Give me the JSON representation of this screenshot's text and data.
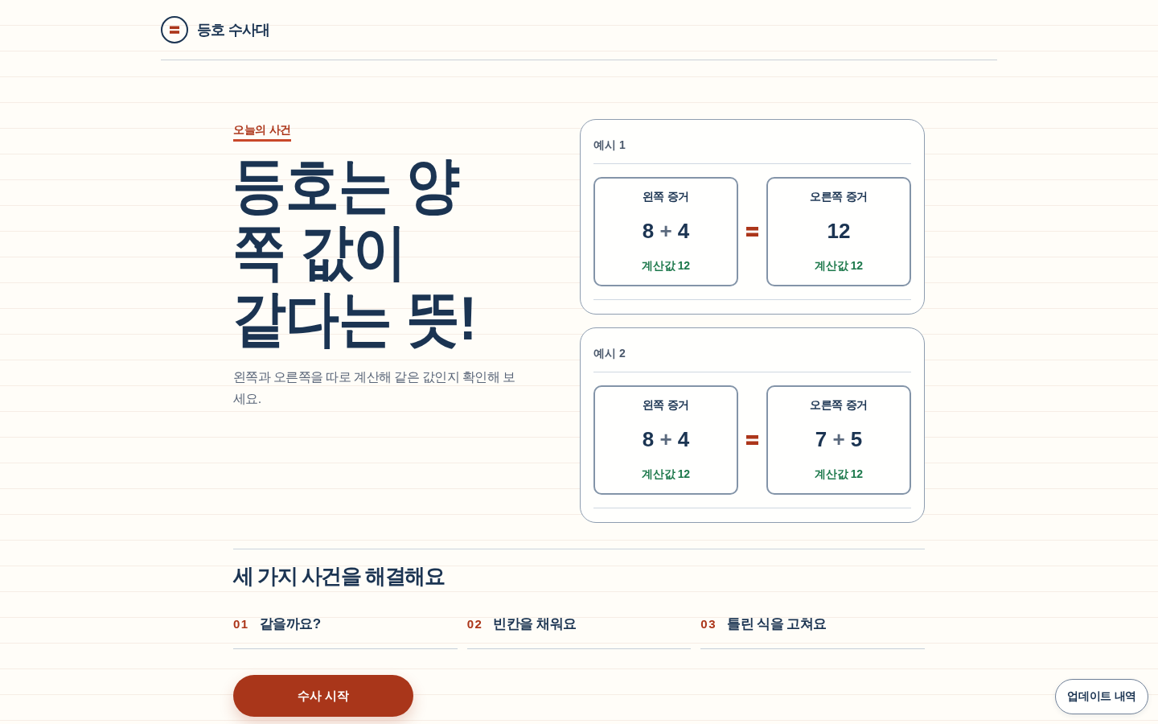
{
  "header": {
    "title": "등호 수사대"
  },
  "hero": {
    "eyebrow": "오늘의 사건",
    "headline": "등호는 양쪽 값이\n같다는 뜻!",
    "description": "왼쪽과 오른쪽을 따로 계산해 같은 값인지 확인해 보세요."
  },
  "examples": [
    {
      "title": "예시 1",
      "sides": [
        {
          "label": "왼쪽 증거",
          "expression": [
            {
              "kind": "number",
              "text": "8"
            },
            {
              "kind": "operator",
              "text": "+"
            },
            {
              "kind": "number",
              "text": "4"
            }
          ],
          "result": "계산값 12"
        },
        {
          "label": "오른쪽 증거",
          "expression": [
            {
              "kind": "number",
              "text": "12"
            }
          ],
          "result": "계산값 12"
        }
      ]
    },
    {
      "title": "예시 2",
      "sides": [
        {
          "label": "왼쪽 증거",
          "expression": [
            {
              "kind": "number",
              "text": "8"
            },
            {
              "kind": "operator",
              "text": "+"
            },
            {
              "kind": "number",
              "text": "4"
            }
          ],
          "result": "계산값 12"
        },
        {
          "label": "오른쪽 증거",
          "expression": [
            {
              "kind": "number",
              "text": "7"
            },
            {
              "kind": "operator",
              "text": "+"
            },
            {
              "kind": "number",
              "text": "5"
            }
          ],
          "result": "계산값 12"
        }
      ]
    }
  ],
  "missions": {
    "title": "세 가지 사건을 해결해요",
    "steps": [
      {
        "number": "01",
        "title": "같을까요?"
      },
      {
        "number": "02",
        "title": "빈칸을 채워요"
      },
      {
        "number": "03",
        "title": "틀린 식을 고쳐요"
      }
    ]
  },
  "start_button": "수사 시작",
  "updates_button": "업데이트 내역"
}
